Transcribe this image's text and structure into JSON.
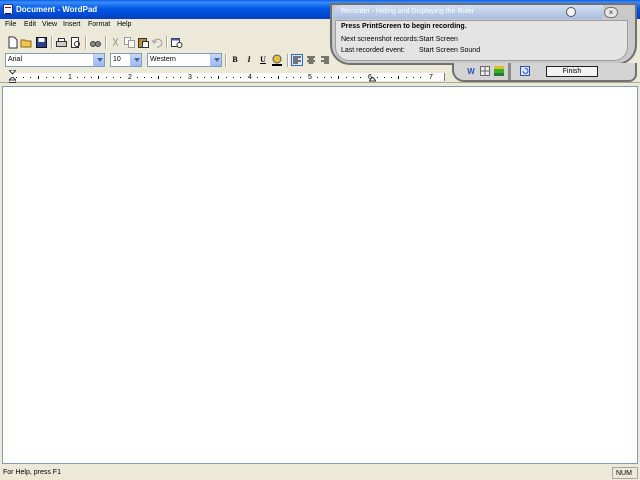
{
  "window": {
    "title": "Document - WordPad"
  },
  "menu": [
    "File",
    "Edit",
    "View",
    "Insert",
    "Format",
    "Help"
  ],
  "toolbar": {
    "icons": [
      "new-icon",
      "open-icon",
      "save-icon",
      "print-icon",
      "print-preview-icon",
      "find-icon",
      "cut-icon",
      "copy-icon",
      "paste-icon",
      "undo-icon",
      "date-time-icon"
    ]
  },
  "format_bar": {
    "font": "Arial",
    "size": "10",
    "script": "Western",
    "bold": "B",
    "italic": "I",
    "underline": "U"
  },
  "ruler": {
    "numbers": [
      "1",
      "2",
      "3",
      "4",
      "5",
      "6",
      "7"
    ]
  },
  "status": {
    "help": "For Help, press F1",
    "num": "NUM"
  },
  "recorder": {
    "title": "Recorder - Hiding and Displaying the Ruler",
    "prompt": "Press PrintScreen to begin recording.",
    "next_label": "Next screenshot records:",
    "next_value": "Start Screen",
    "last_label": "Last recorded event:",
    "last_value": "Start Screen Sound",
    "finish": "Finish",
    "close": "×",
    "toolbar_icons": [
      "word-icon",
      "grid-icon",
      "color-bars-icon",
      "undo-icon"
    ]
  },
  "colors": {
    "titlebar": "#0058e6",
    "recorder_header": "#a8bde0",
    "chrome": "#ece9d8"
  }
}
